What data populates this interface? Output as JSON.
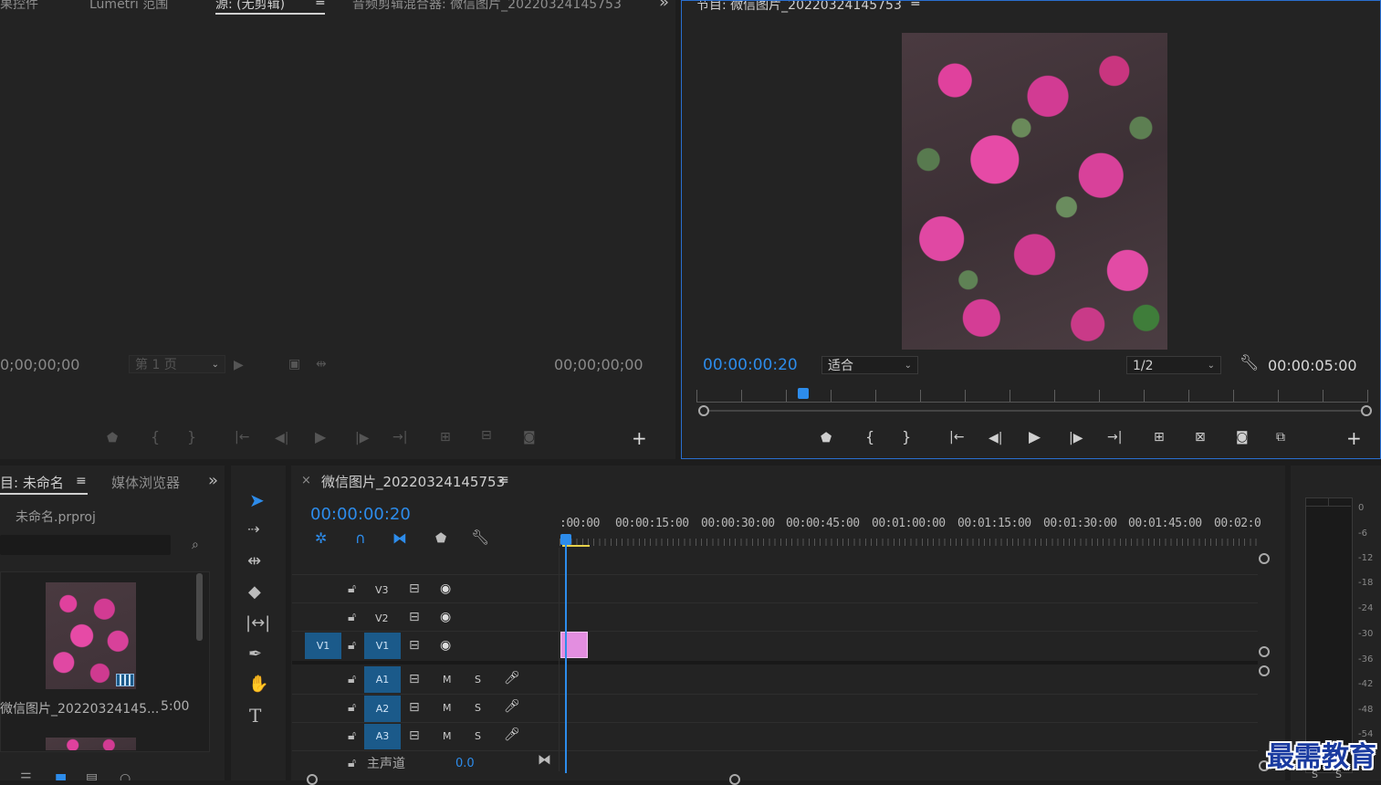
{
  "source_panel": {
    "tabs": [
      "果控件",
      "Lumetri 范围",
      "源: (无剪辑)",
      "音频剪辑混合器: 微信图片_20220324145753"
    ],
    "active_tab_index": 2,
    "menu_glyph": "≡",
    "overflow_glyph": "»",
    "timecode_left": "0;00;00;00",
    "page_select": "第 1 页",
    "timecode_right": "00;00;00;00"
  },
  "program_panel": {
    "title": "节目: 微信图片_20220324145753",
    "menu_glyph": "≡",
    "timecode": "00:00:00:20",
    "zoom_select": "适合",
    "resolution_select": "1/2",
    "duration": "00:00:05:00",
    "playhead_position": 0.08
  },
  "project_panel": {
    "tabs": [
      "目: 未命名",
      "媒体浏览器"
    ],
    "menu_glyph": "≡",
    "overflow_glyph": "»",
    "project_file": "未命名.prproj",
    "search_value": "",
    "clip_name": "微信图片_20220324145...",
    "clip_duration": "5:00"
  },
  "tools": [
    "selection-tool",
    "track-select-tool",
    "ripple-edit-tool",
    "razor-tool",
    "slip-tool",
    "pen-tool",
    "hand-tool",
    "type-tool"
  ],
  "timeline": {
    "close_glyph": "×",
    "sequence_name": "微信图片_20220324145753",
    "menu_glyph": "≡",
    "timecode": "00:00:00:20",
    "ruler_labels": [
      ":00:00",
      "00:00:15:00",
      "00:00:30:00",
      "00:00:45:00",
      "00:01:00:00",
      "00:01:15:00",
      "00:01:30:00",
      "00:01:45:00",
      "00:02:0"
    ],
    "video_tracks": [
      {
        "label": "V3",
        "source": ""
      },
      {
        "label": "V2",
        "source": ""
      },
      {
        "label": "V1",
        "source": "V1"
      }
    ],
    "audio_tracks": [
      {
        "label": "A1",
        "m": "M",
        "s": "S"
      },
      {
        "label": "A2",
        "m": "M",
        "s": "S"
      },
      {
        "label": "A3",
        "m": "M",
        "s": "S"
      }
    ],
    "master": {
      "label": "主声道",
      "value": "0.0"
    },
    "clip_color": "#e38ee0"
  },
  "audio_meter": {
    "scale": [
      "0",
      "-6",
      "-12",
      "-18",
      "-24",
      "-30",
      "-36",
      "-42",
      "-48",
      "-54"
    ],
    "solo_labels": [
      "S",
      "S"
    ]
  },
  "watermark": "最需教育",
  "colors": {
    "accent_blue": "#2d8ceb",
    "track_target": "#1b5a8a",
    "panel_bg": "#232323",
    "app_bg": "#1d1d1d"
  }
}
